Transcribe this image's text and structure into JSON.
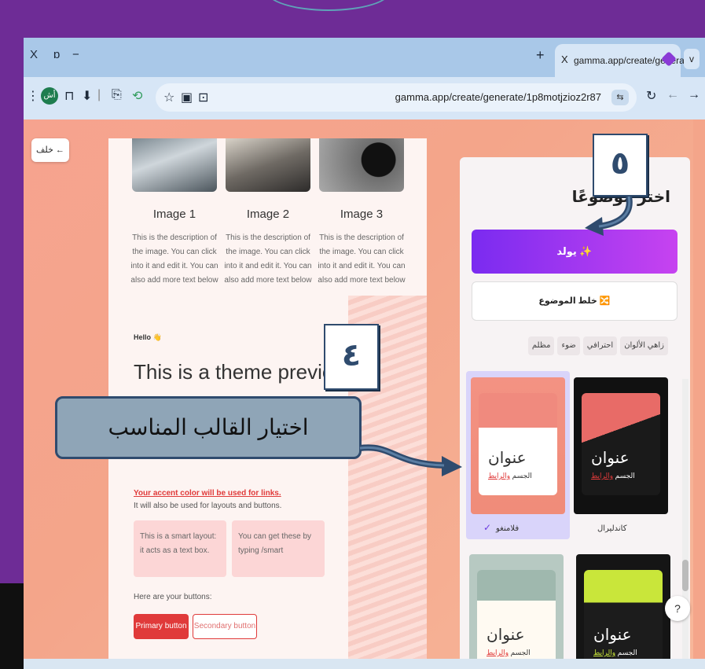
{
  "browser": {
    "title_controls": [
      "X",
      "ɒ",
      "−"
    ],
    "new_tab": "+",
    "tab": {
      "close": "X",
      "title": "gamma.app/create/generate"
    },
    "tab_menu": "v",
    "toolbar_icons": [
      "⋮",
      "⊓",
      "⊔",
      "⬇",
      "|",
      "⎘",
      "⟲",
      "☆",
      "▣",
      "⊡"
    ],
    "avatar_text": "أش",
    "url": "gamma.app/create/generate/1p8motjzioz2r87",
    "url_button": "⇆",
    "nav": [
      "↻",
      "←",
      "→"
    ]
  },
  "page": {
    "back_label": "خلف ←",
    "preview": {
      "images": [
        {
          "title": "Image 1",
          "desc": "This is the description of the image. You can click into it and edit it. You can also add more text below"
        },
        {
          "title": "Image 2",
          "desc": "This is the description of the image. You can click into it and edit it. You can also add more text below"
        },
        {
          "title": "Image 3",
          "desc": "This is the description of the image. You can click into it and edit it. You can also add more text below"
        }
      ],
      "hello": "Hello 👋",
      "theme_title": "This is a theme preview",
      "accent_link": "Your accent color will be used for links.",
      "accent_sub": "It will also be used for layouts and buttons.",
      "smart_boxes": [
        "This is a smart layout: it acts as a text box.",
        "You can get these by typing /smart"
      ],
      "buttons_label": "Here are your buttons:",
      "primary_button": "Primary button",
      "secondary_button": "Secondary button"
    },
    "panel": {
      "title": "اختر موضوعًا",
      "generate": "يولد ✨",
      "shuffle": "خلط الموضوع 🔀",
      "filters": [
        "زاهي الألوان",
        "احترافي",
        "ضوء",
        "مظلم"
      ],
      "cards": [
        {
          "title": "عنوان",
          "body": "الجسم",
          "link": "والرابط",
          "name": "فلامنغو",
          "selected": true
        },
        {
          "title": "عنوان",
          "body": "الجسم",
          "link": "والرابط",
          "name": "كاندليرال",
          "selected": false
        },
        {
          "title": "عنوان",
          "body": "الجسم",
          "link": "والرابط",
          "name": "",
          "selected": false
        },
        {
          "title": "عنوان",
          "body": "الجسم",
          "link": "والرابط",
          "name": "",
          "selected": false
        }
      ],
      "check": "✓",
      "help": "?"
    }
  },
  "annotations": {
    "badge_5": "٥",
    "badge_4": "٤",
    "callout": "اختيار القالب المناسب"
  }
}
